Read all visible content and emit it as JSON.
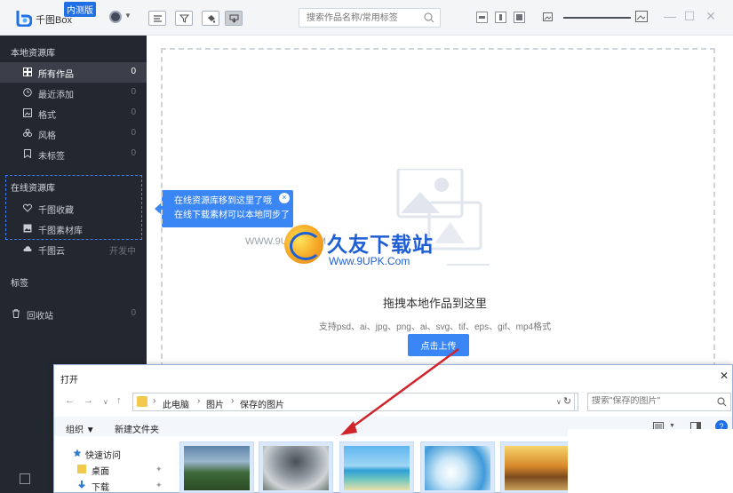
{
  "app": {
    "logo_text": "千图Box",
    "badge": "内测版"
  },
  "toolbar": {
    "search_placeholder": "搜索作品名称/常用标签"
  },
  "sidebar": {
    "local_title": "本地资源库",
    "local_items": [
      {
        "label": "所有作品",
        "count": "0",
        "icon": "grid-icon"
      },
      {
        "label": "最近添加",
        "count": "0",
        "icon": "clock-icon"
      },
      {
        "label": "格式",
        "count": "0",
        "icon": "image-icon"
      },
      {
        "label": "风格",
        "count": "0",
        "icon": "flower-icon"
      },
      {
        "label": "未标签",
        "count": "0",
        "icon": "bookmark-icon"
      }
    ],
    "online_title": "在线资源库",
    "online_items": [
      {
        "label": "千图收藏",
        "icon": "heart-icon"
      },
      {
        "label": "千图素材库",
        "icon": "picture-icon"
      }
    ],
    "cloud_item": {
      "label": "千图云",
      "status": "开发中"
    },
    "tags_title": "标签",
    "recycle": {
      "label": "回收站",
      "count": "0"
    }
  },
  "tooltip": {
    "line1": "在线资源库移到这里了哦",
    "line2": "在线下载素材可以本地同步了"
  },
  "dropzone": {
    "title": "拖拽本地作品到这里",
    "formats": "支持psd、ai、jpg、png、ai、svg、tif、eps、gif、mp4格式",
    "upload_label": "点击上传"
  },
  "watermark": {
    "brand": "久友下载站",
    "url": "Www.9UPK.Com",
    "ghost": "WWW.9UPK.COM"
  },
  "dialog": {
    "title": "打开",
    "breadcrumbs": [
      "此电脑",
      "图片",
      "保存的图片"
    ],
    "search_placeholder": "搜索\"保存的图片\"",
    "organize": "组织 ▼",
    "new_folder": "新建文件夹",
    "tree": [
      {
        "label": "快速访问"
      },
      {
        "label": "桌面"
      },
      {
        "label": "下载"
      }
    ]
  },
  "colors": {
    "accent": "#3b86f5",
    "sidebar_bg": "#23272f",
    "annotation_arrow": "#d0242b"
  }
}
